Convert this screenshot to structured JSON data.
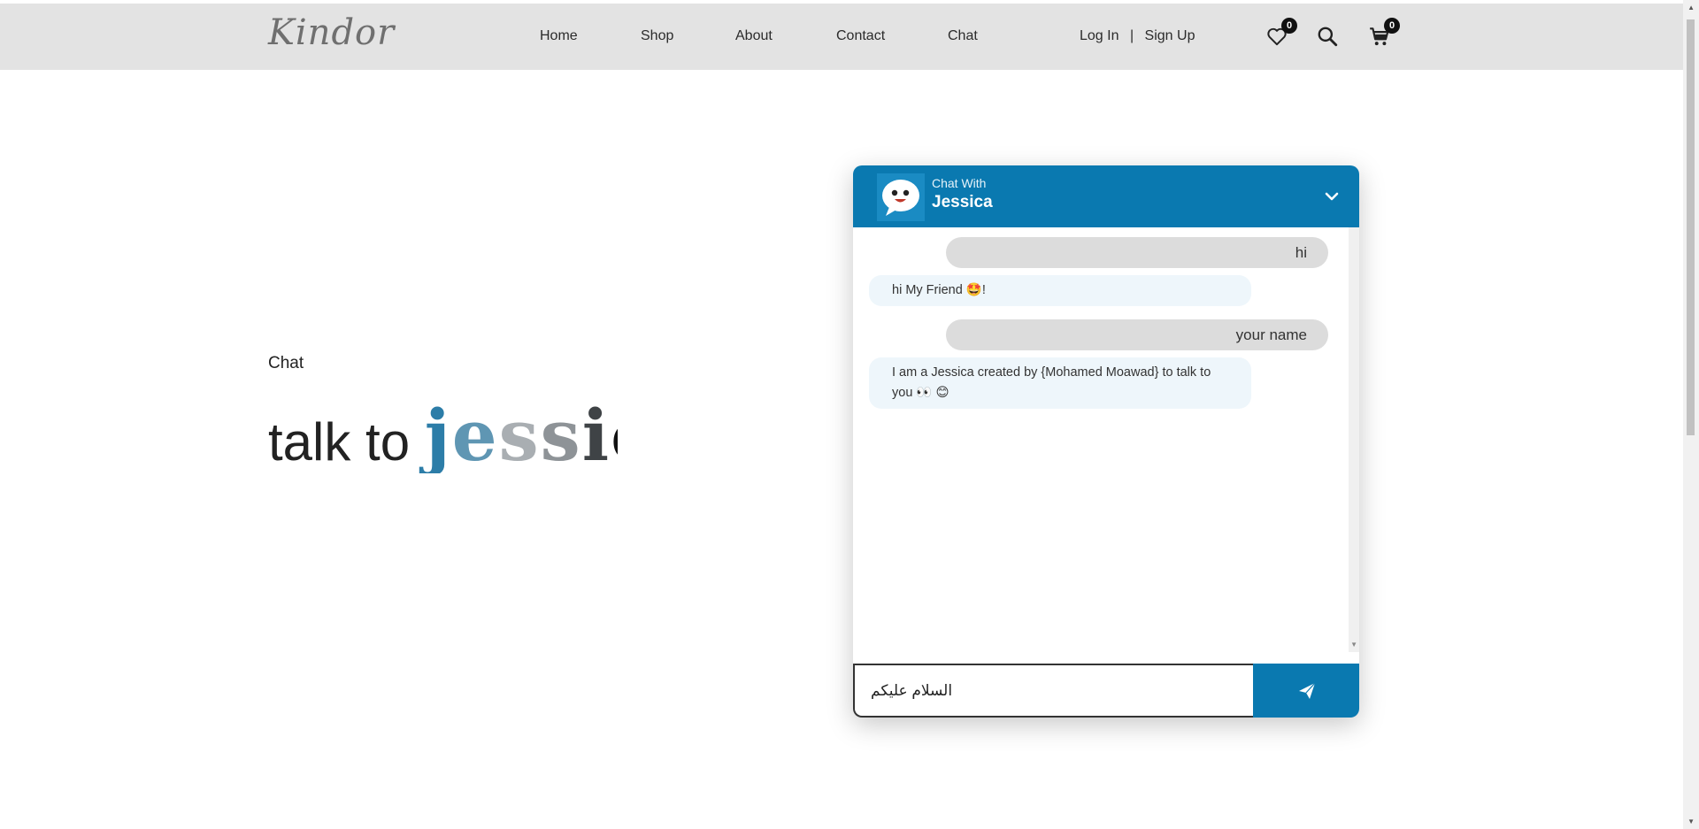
{
  "header": {
    "logo": "Kindor",
    "nav": [
      {
        "label": "Home"
      },
      {
        "label": "Shop"
      },
      {
        "label": "About"
      },
      {
        "label": "Contact"
      },
      {
        "label": "Chat"
      }
    ],
    "auth": {
      "login": "Log In",
      "separator": "|",
      "signup": "Sign Up"
    },
    "icons": {
      "wishlist": {
        "icon": "heart-icon",
        "count": "0"
      },
      "search": {
        "icon": "search-icon"
      },
      "cart": {
        "icon": "cart-icon",
        "count": "0"
      }
    }
  },
  "hero": {
    "eyebrow": "Chat",
    "title_prefix": "talk to",
    "title_name_letters": [
      "j",
      "e",
      "s",
      "s",
      "i",
      "c"
    ]
  },
  "chat": {
    "header": {
      "subtitle": "Chat With",
      "name": "Jessica"
    },
    "messages": [
      {
        "from": "user",
        "text": "hi"
      },
      {
        "from": "bot",
        "text": "hi My Friend 🤩!"
      },
      {
        "from": "user",
        "text": "your name"
      },
      {
        "from": "bot",
        "text": "I am a Jessica created by {Mohamed Moawad} to talk to you 👀 😊"
      }
    ],
    "input_value": "السلام عليكم",
    "colors": {
      "accent": "#0a79b0",
      "user_bubble": "#dcdcdc",
      "bot_bubble": "#eef6fb"
    }
  }
}
